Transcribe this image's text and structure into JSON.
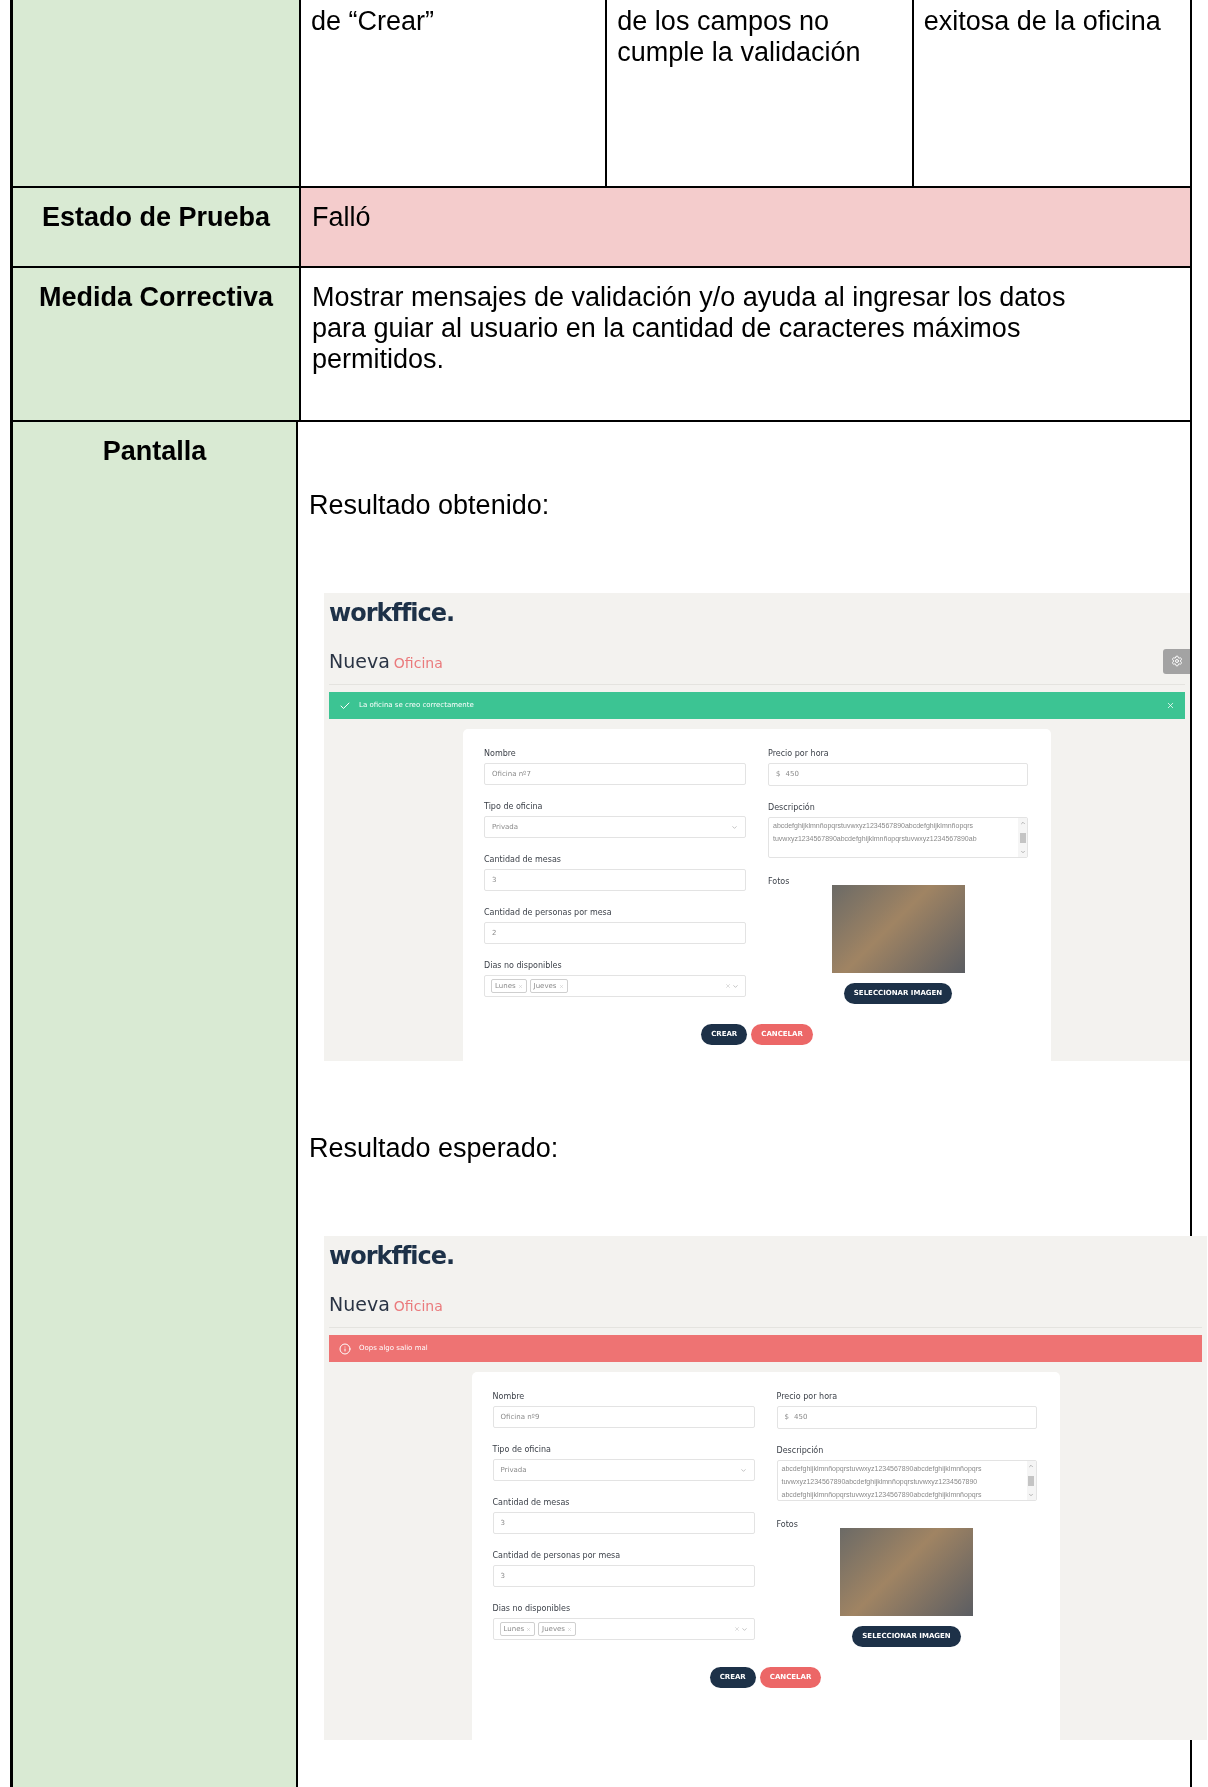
{
  "top_row": {
    "cells": [
      "de “Crear”",
      "de los campos no cumple la validación",
      "exitosa de la oficina"
    ]
  },
  "rows": [
    {
      "label": "Estado de Prueba",
      "value": "Falló",
      "kind": "status"
    },
    {
      "label": "Medida Correctiva",
      "value": "Mostrar mensajes de validación y/o ayuda al ingresar los datos para guiar al usuario en la cantidad de caracteres máximos permitidos.",
      "kind": "text"
    }
  ],
  "screen_row": {
    "label": "Pantalla",
    "sections": [
      {
        "caption": "Resultado obtenido:",
        "screenshot": {
          "logo": "workffice.",
          "title": "Nueva",
          "title_accent": "Oficina",
          "settings_button": true,
          "alert": {
            "kind": "success",
            "message": "La oficina se creo correctamente",
            "closable": true
          },
          "left_fields": [
            {
              "label": "Nombre",
              "value": "Oficina nº7",
              "kind": "text"
            },
            {
              "label": "Tipo de oficina",
              "value": "Privada",
              "kind": "select"
            },
            {
              "label": "Cantidad de mesas",
              "value": "3",
              "kind": "text"
            },
            {
              "label": "Cantidad de personas por mesa",
              "value": "2",
              "kind": "text"
            },
            {
              "label": "Dias no disponibles",
              "kind": "multiselect",
              "tags": [
                "Lunes",
                "Jueves"
              ]
            }
          ],
          "price": {
            "label": "Precio por hora",
            "prefix": "$",
            "value": "450"
          },
          "description": {
            "label": "Descripción",
            "lines": [
              "abcdefghijklmnñopqrstuvwxyz1234567890abcdefghijklmnñopqrs",
              "tuvwxyz1234567890abcdefghijklmnñopqrstuvwxyz1234567890ab"
            ]
          },
          "photos": {
            "label": "Fotos",
            "button": "SELECCIONAR IMAGEN"
          },
          "buttons": [
            {
              "label": "CREAR",
              "kind": "primary"
            },
            {
              "label": "CANCELAR",
              "kind": "danger"
            }
          ]
        }
      },
      {
        "caption": "Resultado esperado:",
        "screenshot": {
          "logo": "workffice.",
          "title": "Nueva",
          "title_accent": "Oficina",
          "settings_button": false,
          "alert": {
            "kind": "error",
            "message": "Oops algo salio mal",
            "closable": false
          },
          "left_fields": [
            {
              "label": "Nombre",
              "value": "Oficina nº9",
              "kind": "text"
            },
            {
              "label": "Tipo de oficina",
              "value": "Privada",
              "kind": "select"
            },
            {
              "label": "Cantidad de mesas",
              "value": "3",
              "kind": "text"
            },
            {
              "label": "Cantidad de personas por mesa",
              "value": "3",
              "kind": "text"
            },
            {
              "label": "Dias no disponibles",
              "kind": "multiselect",
              "tags": [
                "Lunes",
                "Jueves"
              ]
            }
          ],
          "price": {
            "label": "Precio por hora",
            "prefix": "$",
            "value": "450"
          },
          "description": {
            "label": "Descripción",
            "lines": [
              "abcdefghijklmnñopqrstuvwxyz1234567890abcdefghijklmnñopqrs",
              "tuvwxyz1234567890abcdefghijklmnñopqrstuvwxyz1234567890",
              "abcdefghijklmnñopqrstuvwxyz1234567890abcdefghijklmnñopqrs"
            ]
          },
          "photos": {
            "label": "Fotos",
            "button": "SELECCIONAR IMAGEN"
          },
          "buttons": [
            {
              "label": "CREAR",
              "kind": "primary"
            },
            {
              "label": "CANCELAR",
              "kind": "danger"
            }
          ]
        }
      }
    ]
  }
}
